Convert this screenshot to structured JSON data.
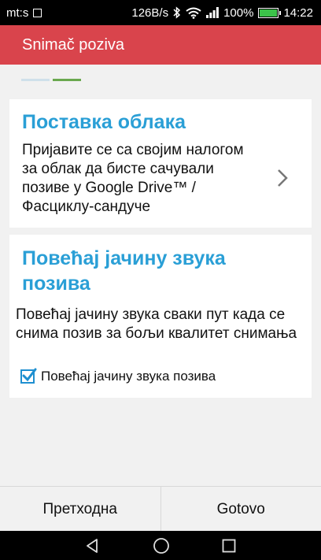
{
  "status_bar": {
    "left_text": "mt:s",
    "speed": "126B/s",
    "battery": "100%",
    "time": "14:22"
  },
  "app_bar": {
    "title": "Snimač poziva"
  },
  "steps": {
    "completed_color": "#cfe0ea",
    "active_color": "#6aa84f"
  },
  "cloud_card": {
    "title": "Поставка облака",
    "description": "Пријавите се са својим налогом за облак да бисте сачували позиве у Google Drive™ / Фасциклу-сандуче"
  },
  "volume_card": {
    "title": "Повећај јачину звука позива",
    "description": "Повећај јачину звука сваки пут када се снима позив за бољи квалитет снимања",
    "checkbox_label": "Повећај јачину звука позива",
    "checkbox_checked": true
  },
  "bottom": {
    "prev_label": "Претходна",
    "done_label": "Gotovo"
  },
  "icons": {
    "status": [
      "image-icon",
      "bluetooth-icon",
      "wifi-icon",
      "signal-icon",
      "battery-icon"
    ],
    "card": "chevron-right-icon",
    "nav": [
      "back-icon",
      "home-icon",
      "recents-icon"
    ]
  },
  "colors": {
    "accent": "#d9444c",
    "title": "#2a9fd6",
    "battery": "#3cc24a"
  }
}
